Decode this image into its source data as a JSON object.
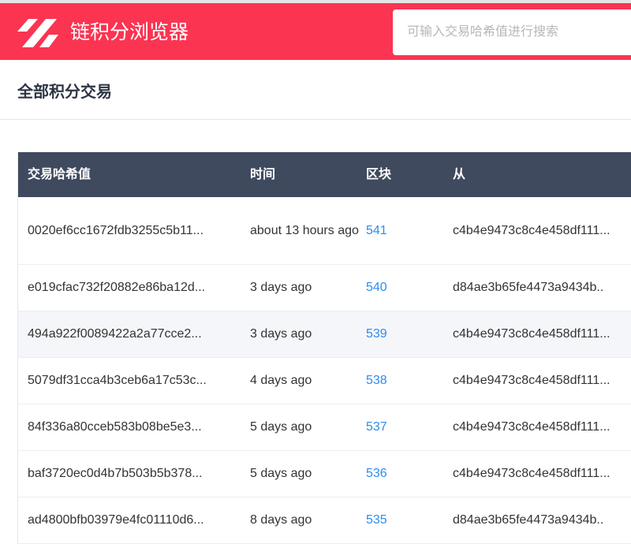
{
  "header": {
    "brand": "链积分浏览器",
    "search_placeholder": "可输入交易哈希值进行搜索"
  },
  "page_title": "全部积分交易",
  "table": {
    "columns": [
      "交易哈希值",
      "时间",
      "区块",
      "从"
    ],
    "rows": [
      {
        "hash": "0020ef6cc1672fdb3255c5b11...",
        "time": "about 13 hours ago",
        "block": "541",
        "from": "c4b4e9473c8c4e458df111..."
      },
      {
        "hash": "e019cfac732f20882e86ba12d...",
        "time": "3 days ago",
        "block": "540",
        "from": "d84ae3b65fe4473a9434b.."
      },
      {
        "hash": "494a922f0089422a2a77cce2...",
        "time": "3 days ago",
        "block": "539",
        "from": "c4b4e9473c8c4e458df111..."
      },
      {
        "hash": "5079df31cca4b3ceb6a17c53c...",
        "time": "4 days ago",
        "block": "538",
        "from": "c4b4e9473c8c4e458df111..."
      },
      {
        "hash": "84f336a80cceb583b08be5e3...",
        "time": "5 days ago",
        "block": "537",
        "from": "c4b4e9473c8c4e458df111..."
      },
      {
        "hash": "baf3720ec0d4b7b503b5b378...",
        "time": "5 days ago",
        "block": "536",
        "from": "c4b4e9473c8c4e458df111..."
      },
      {
        "hash": "ad4800bfb03979e4fc01110d6...",
        "time": "8 days ago",
        "block": "535",
        "from": "d84ae3b65fe4473a9434b.."
      }
    ]
  }
}
